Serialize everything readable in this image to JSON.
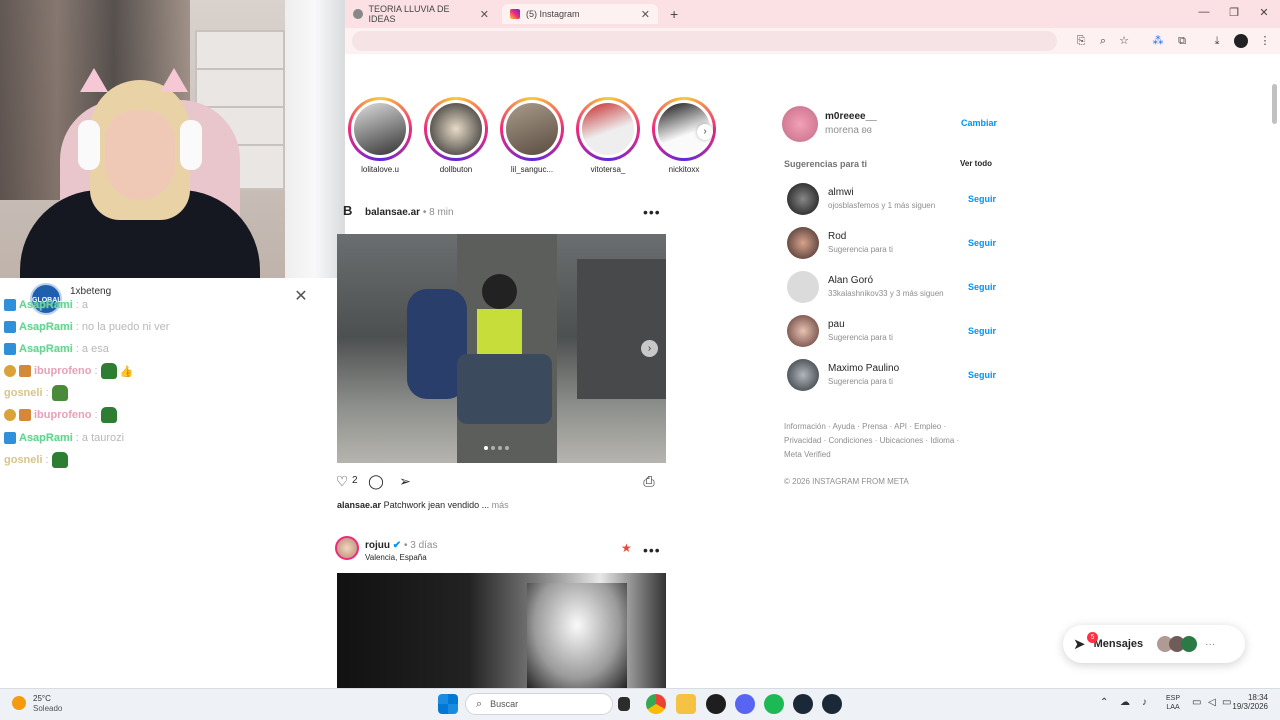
{
  "browser": {
    "tabs": [
      {
        "label": "TEORIA LLUVIA DE IDEAS",
        "active": false
      },
      {
        "label": "(5) Instagram",
        "active": true
      }
    ],
    "new_tab": "+"
  },
  "chat": {
    "sponsor_logo": "GLOBAL",
    "sponsor_name": "1xbeteng",
    "messages": [
      {
        "user": "AsapRami",
        "text": ": a",
        "color": "green"
      },
      {
        "user": "AsapRami",
        "text": ": no la puedo ni ver",
        "color": "green"
      },
      {
        "user": "AsapRami",
        "text": ": a esa",
        "color": "green"
      },
      {
        "user": "ibuprofeno",
        "text": ":",
        "color": "pink"
      },
      {
        "user": "gosneli",
        "text": ":",
        "color": "yellow"
      },
      {
        "user": "ibuprofeno",
        "text": ":",
        "color": "pink"
      },
      {
        "user": "AsapRami",
        "text": ": a taurozi",
        "color": "green"
      },
      {
        "user": "gosneli",
        "text": ":",
        "color": "yellow"
      }
    ]
  },
  "stories": [
    {
      "name": "lolitalove.u"
    },
    {
      "name": "dollbuton"
    },
    {
      "name": "lil_sanguc..."
    },
    {
      "name": "vitotersa_"
    },
    {
      "name": "nickitoxx"
    }
  ],
  "post1": {
    "logo": "B",
    "user": "balansae.ar",
    "time": "• 8 min",
    "likes": "2",
    "caption_user": "alansae.ar",
    "caption_text": "Patchwork jean vendido ...",
    "more": "más"
  },
  "post2": {
    "user": "rojuu",
    "verified": "✔",
    "time": "• 3 días",
    "location": "Valencia, España"
  },
  "profile": {
    "username": "m0reeee__",
    "fullname": "morena ʚɞ",
    "switch": "Cambiar"
  },
  "suggestions": {
    "title": "Sugerencias para ti",
    "see_all": "Ver todo",
    "follow": "Seguir",
    "items": [
      {
        "name": "almwi",
        "sub": "ojosblasfemos y 1 más siguen"
      },
      {
        "name": "Rod",
        "sub": "Sugerencia para ti"
      },
      {
        "name": "Alan Goró",
        "sub": "33kalashnikov33 y 3 más siguen"
      },
      {
        "name": "pau",
        "sub": "Sugerencia para ti"
      },
      {
        "name": "Maximo Paulino",
        "sub": "Sugerencia para ti"
      }
    ]
  },
  "footer": {
    "line1": "Información · Ayuda · Prensa · API · Empleo ·",
    "line2": "Privacidad · Condiciones · Ubicaciones · Idioma ·",
    "line3": "Meta Verified",
    "copyright": "© 2026 INSTAGRAM FROM META"
  },
  "messages_btn": {
    "label": "Mensajes",
    "count": "5"
  },
  "taskbar": {
    "weather_temp": "25°C",
    "weather_desc": "Soleado",
    "search": "Buscar",
    "lang1": "ESP",
    "lang2": "LAA",
    "time": "18:34",
    "date": "19/3/2026"
  },
  "colors": {
    "tabbar_bg": "#fbe1e3",
    "accent_blue": "#0095f6",
    "chat_green": "#6cd09a"
  }
}
